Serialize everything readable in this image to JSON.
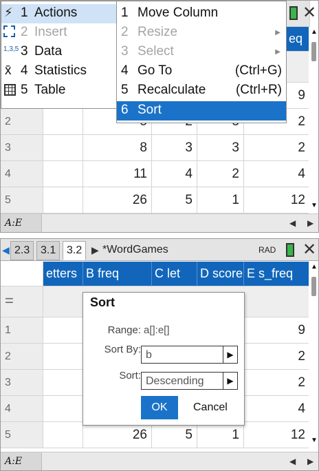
{
  "top": {
    "menu": {
      "items": [
        {
          "num": "1",
          "label": "Actions"
        },
        {
          "num": "2",
          "label": "Insert"
        },
        {
          "num": "3",
          "label": "Data"
        },
        {
          "num": "4",
          "label": "Statistics"
        },
        {
          "num": "5",
          "label": "Table"
        }
      ]
    },
    "submenu": {
      "items": [
        {
          "num": "1",
          "label": "Move Column",
          "shortcut": ""
        },
        {
          "num": "2",
          "label": "Resize",
          "shortcut": ""
        },
        {
          "num": "3",
          "label": "Select",
          "shortcut": ""
        },
        {
          "num": "4",
          "label": "Go To",
          "shortcut": "(Ctrl+G)"
        },
        {
          "num": "5",
          "label": "Recalculate",
          "shortcut": "(Ctrl+R)"
        },
        {
          "num": "6",
          "label": "Sort",
          "shortcut": ""
        }
      ]
    },
    "header_partial": "eq",
    "rows": [
      {
        "n": "2",
        "b": "5",
        "c": "2",
        "d": "3",
        "e": "2"
      },
      {
        "n": "3",
        "b": "8",
        "c": "3",
        "d": "3",
        "e": "2"
      },
      {
        "n": "4",
        "b": "11",
        "c": "4",
        "d": "2",
        "e": "4"
      },
      {
        "n": "5",
        "b": "26",
        "c": "5",
        "d": "1",
        "e": "12"
      }
    ],
    "row1_e": "9",
    "cell_ref": "A:E"
  },
  "bottom": {
    "tabs": [
      "2.3",
      "3.1",
      "3.2"
    ],
    "doc_title": "*WordGames",
    "mode": "RAD",
    "columns": [
      {
        "letter": "",
        "name": "etters"
      },
      {
        "letter": "B",
        "name": "freq"
      },
      {
        "letter": "C",
        "name": "let"
      },
      {
        "letter": "D",
        "name": "score"
      },
      {
        "letter": "E",
        "name": "s_freq"
      }
    ],
    "eq_symbol": "=",
    "row_nums": [
      "1",
      "2",
      "3",
      "4",
      "5"
    ],
    "e_values": [
      "9",
      "2",
      "2",
      "4"
    ],
    "row5": {
      "b": "26",
      "c": "5",
      "d": "1",
      "e": "12"
    },
    "cell_ref": "A:E",
    "dialog": {
      "title": "Sort",
      "range_label": "Range:",
      "range_value": "a[]:e[]",
      "sortby_label": "Sort By:",
      "sortby_value": "b",
      "sort_label": "Sort:",
      "sort_value": "Descending",
      "ok": "OK",
      "cancel": "Cancel"
    }
  },
  "colors": {
    "header_blue": "#1166bb",
    "selection_blue": "#1a73c8",
    "battery_green": "#39b54a"
  }
}
